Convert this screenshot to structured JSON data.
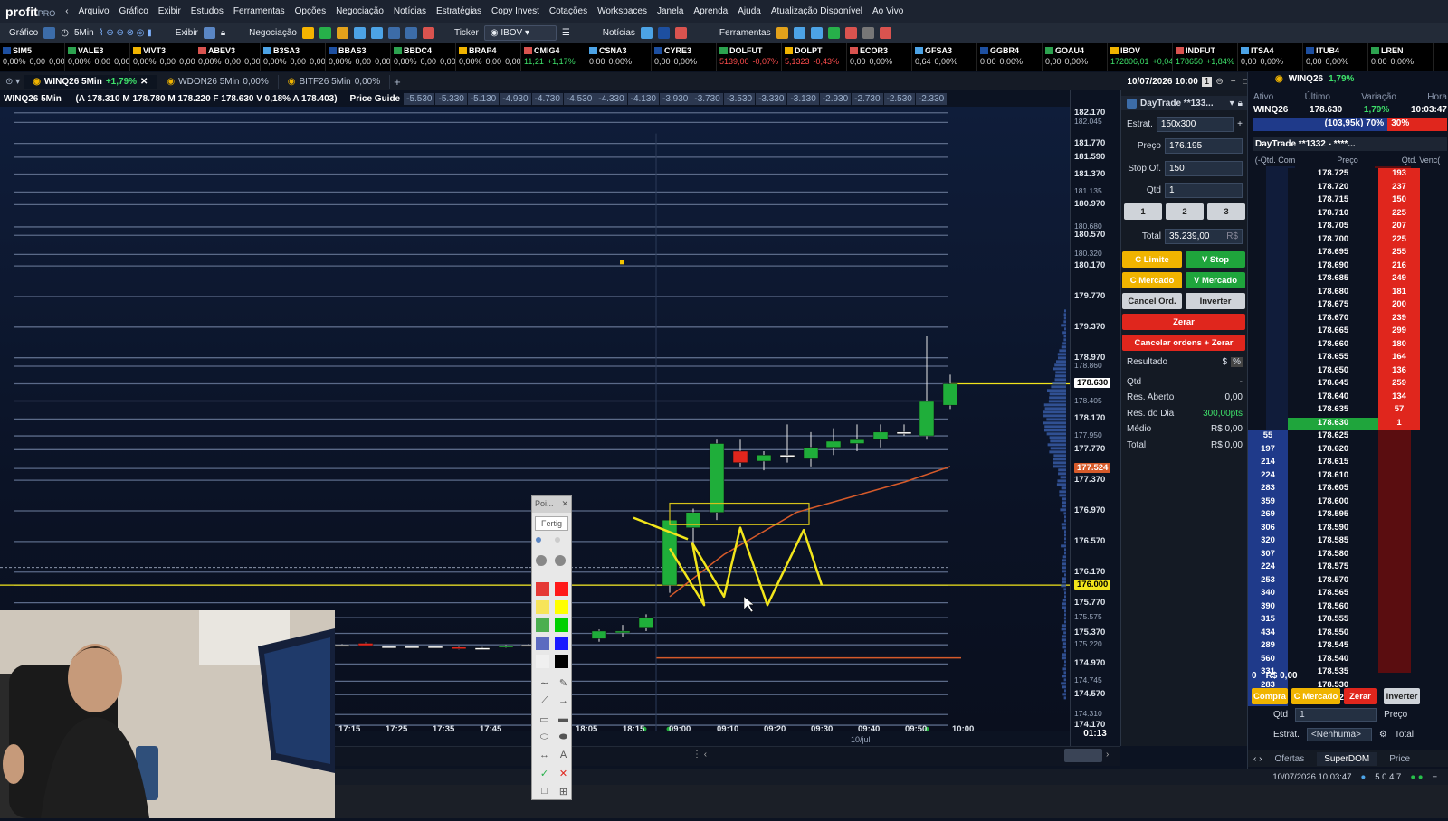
{
  "app": {
    "logo": "profit",
    "edition": "PRO"
  },
  "menu": [
    "Arquivo",
    "Gráfico",
    "Exibir",
    "Estudos",
    "Ferramentas",
    "Opções",
    "Negociação",
    "Notícias",
    "Estratégias",
    "Copy Invest",
    "Cotações",
    "Workspaces",
    "Janela",
    "Aprenda",
    "Ajuda",
    "Atualização Disponível",
    "Ao Vivo"
  ],
  "toolbar": {
    "grafico": "Gráfico",
    "interval": "5Min",
    "exibir": "Exibir",
    "negociacao": "Negociação",
    "ticker_label": "Ticker",
    "ticker_value": "IBOV",
    "noticias": "Notícias",
    "ferramentas": "Ferramentas"
  },
  "ticker_strip": [
    {
      "sym": "SIM5",
      "q": "0,00%",
      "v": "0,00",
      "c": "0,00%",
      "cls": "q"
    },
    {
      "sym": "VALE3",
      "q": "0,00%",
      "v": "0,00",
      "c": "0,00%",
      "cls": "q"
    },
    {
      "sym": "VIVT3",
      "q": "0,00%",
      "v": "0,00",
      "c": "0,00%",
      "cls": "q"
    },
    {
      "sym": "ABEV3",
      "q": "0,00%",
      "v": "0,00",
      "c": "0,00%",
      "cls": "q"
    },
    {
      "sym": "B3SA3",
      "q": "0,00%",
      "v": "0,00",
      "c": "0,00%",
      "cls": "q"
    },
    {
      "sym": "BBAS3",
      "q": "0,00%",
      "v": "0,00",
      "c": "0,00%",
      "cls": "q"
    },
    {
      "sym": "BBDC4",
      "q": "0,00%",
      "v": "0,00",
      "c": "0,00%",
      "cls": "q"
    },
    {
      "sym": "BRAP4",
      "q": "0,00%",
      "v": "0,00",
      "c": "0,00%",
      "cls": "q"
    },
    {
      "sym": "CMIG4",
      "q": "11,21",
      "v": "+1,17%",
      "c": "",
      "cls": "pos"
    },
    {
      "sym": "CSNA3",
      "q": "0,00",
      "v": "0,00%",
      "c": "",
      "cls": "q"
    },
    {
      "sym": "CYRE3",
      "q": "0,00",
      "v": "0,00%",
      "c": "",
      "cls": "q"
    },
    {
      "sym": "DOLFUT",
      "q": "5139,00",
      "v": "-0,07%",
      "c": "",
      "cls": "neg"
    },
    {
      "sym": "DOLPT",
      "q": "5,1323",
      "v": "-0,43%",
      "c": "",
      "cls": "neg"
    },
    {
      "sym": "ECOR3",
      "q": "0,00",
      "v": "0,00%",
      "c": "",
      "cls": "q"
    },
    {
      "sym": "GFSA3",
      "q": "0,64",
      "v": "0,00%",
      "c": "",
      "cls": "q"
    },
    {
      "sym": "GGBR4",
      "q": "0,00",
      "v": "0,00%",
      "c": "",
      "cls": "q"
    },
    {
      "sym": "GOAU4",
      "q": "0,00",
      "v": "0,00%",
      "c": "",
      "cls": "q"
    },
    {
      "sym": "IBOV",
      "q": "172806,01",
      "v": "+0,04%",
      "c": "",
      "cls": "pos"
    },
    {
      "sym": "INDFUT",
      "q": "178650",
      "v": "+1,84%",
      "c": "",
      "cls": "pos"
    },
    {
      "sym": "ITSA4",
      "q": "0,00",
      "v": "0,00%",
      "c": "",
      "cls": "q"
    },
    {
      "sym": "ITUB4",
      "q": "0,00",
      "v": "0,00%",
      "c": "",
      "cls": "q"
    },
    {
      "sym": "LREN",
      "q": "0,00",
      "v": "0,00%",
      "c": "",
      "cls": "q"
    }
  ],
  "tabs": [
    {
      "label": "WINQ26 5Min",
      "chg": "+1,79%",
      "active": true
    },
    {
      "label": "WDON26 5Min",
      "chg": "0,00%"
    },
    {
      "label": "BITF26 5Min",
      "chg": "0,00%"
    }
  ],
  "header_right": {
    "datetime": "10/07/2026 10:00",
    "num": "1"
  },
  "chart_info": {
    "text": "WINQ26 5Min — (A 178.310 M 178.780 M 178.220 F 178.630 V 0,18% A 178.403)",
    "price_guide": "Price Guide",
    "guides": [
      "-5.530",
      "-5.330",
      "-5.130",
      "-4.930",
      "-4.730",
      "-4.530",
      "-4.330",
      "-4.130",
      "-3.930",
      "-3.730",
      "-3.530",
      "-3.330",
      "-3.130",
      "-2.930",
      "-2.730",
      "-2.530",
      "-2.330"
    ]
  },
  "price_axis": [
    "182.170",
    "182.045",
    "181.770",
    "181.590",
    "181.370",
    "181.135",
    "180.970",
    "180.680",
    "180.570",
    "180.320",
    "180.170",
    "179.770",
    "179.370",
    "178.970",
    "178.860",
    "178.630",
    "178.405",
    "178.170",
    "177.950",
    "177.770",
    "177.524",
    "177.370",
    "176.970",
    "176.570",
    "176.170",
    "176.000",
    "175.770",
    "175.575",
    "175.370",
    "175.220",
    "174.970",
    "174.745",
    "174.570",
    "174.310",
    "174.170"
  ],
  "time_axis": [
    "17:15",
    "17:25",
    "17:35",
    "17:45",
    "18:05",
    "18:15",
    "09:00",
    "09:10",
    "09:20",
    "09:30",
    "09:40",
    "09:50",
    "10:00"
  ],
  "date_label": "10/jul",
  "countdown": "01:13",
  "order": {
    "account": "DayTrade **133...",
    "estrat_label": "Estrat.",
    "estrat": "150x300",
    "preco_label": "Preço",
    "preco": "176.195",
    "stop_label": "Stop Of.",
    "stop": "150",
    "qtd_label": "Qtd",
    "qtd": "1",
    "q1": "1",
    "q2": "2",
    "q3": "3",
    "total_label": "Total",
    "total": "35.239,00",
    "currency": "R$",
    "c_limite": "C Limite",
    "v_stop": "V Stop",
    "c_mercado": "C Mercado",
    "v_mercado": "V Mercado",
    "cancel": "Cancel Ord.",
    "inverter": "Inverter",
    "zerar": "Zerar",
    "cancelar": "Cancelar ordens + Zerar",
    "resultado": "Resultado",
    "res_sym": "$",
    "res_pct": "%",
    "rows": [
      {
        "k": "Qtd",
        "v": "-"
      },
      {
        "k": "Res. Aberto",
        "v": "0,00"
      },
      {
        "k": "Res. do Dia",
        "v": "300,00pts"
      },
      {
        "k": "Médio",
        "v": "R$ 0,00"
      },
      {
        "k": "Total",
        "v": "R$ 0,00"
      }
    ]
  },
  "dom": {
    "header": {
      "ativo": "Ativo",
      "ultimo": "Último",
      "variacao": "Variação",
      "hora": "Hora"
    },
    "sym": "WINQ26",
    "last": "178.630",
    "chg": "1,79%",
    "time": "10:03:47",
    "vol": "(103,95k) 70%",
    "pct": "30%",
    "account": "DayTrade **1332 - ****...",
    "senha": "Senha",
    "cols": [
      "(-Qtd. Com",
      "Preço",
      "Qtd. Venc("
    ],
    "asks": [
      [
        "178.725",
        "193"
      ],
      [
        "178.720",
        "237"
      ],
      [
        "178.715",
        "150"
      ],
      [
        "178.710",
        "225"
      ],
      [
        "178.705",
        "207"
      ],
      [
        "178.700",
        "225"
      ],
      [
        "178.695",
        "255"
      ],
      [
        "178.690",
        "216"
      ],
      [
        "178.685",
        "249"
      ],
      [
        "178.680",
        "181"
      ],
      [
        "178.675",
        "200"
      ],
      [
        "178.670",
        "239"
      ],
      [
        "178.665",
        "299"
      ],
      [
        "178.660",
        "180"
      ],
      [
        "178.655",
        "164"
      ],
      [
        "178.650",
        "136"
      ],
      [
        "178.645",
        "259"
      ],
      [
        "178.640",
        "134"
      ],
      [
        "178.635",
        "57"
      ],
      [
        "178.630",
        "1"
      ]
    ],
    "bids": [
      [
        "55",
        "178.625"
      ],
      [
        "197",
        "178.620"
      ],
      [
        "214",
        "178.615"
      ],
      [
        "224",
        "178.610"
      ],
      [
        "283",
        "178.605"
      ],
      [
        "359",
        "178.600"
      ],
      [
        "269",
        "178.595"
      ],
      [
        "306",
        "178.590"
      ],
      [
        "320",
        "178.585"
      ],
      [
        "307",
        "178.580"
      ],
      [
        "224",
        "178.575"
      ],
      [
        "253",
        "178.570"
      ],
      [
        "340",
        "178.565"
      ],
      [
        "390",
        "178.560"
      ],
      [
        "315",
        "178.555"
      ],
      [
        "434",
        "178.550"
      ],
      [
        "289",
        "178.545"
      ],
      [
        "560",
        "178.540"
      ],
      [
        "331",
        "178.535"
      ],
      [
        "283",
        "178.530"
      ],
      [
        "280",
        "178.525"
      ]
    ],
    "footer_qtd": "0",
    "footer_val": "R$ 0,00",
    "compra": "Compra",
    "c_mercado": "C Mercado",
    "zerar": "Zerar",
    "inverter": "Inverter",
    "qtd_label": "Qtd",
    "qtd": "1",
    "preco_label": "Preço",
    "estrat_label": "Estrat.",
    "estrat": "<Nenhuma>",
    "total_label": "Total",
    "tabs": [
      "Ofertas",
      "SuperDOM",
      "Price"
    ]
  },
  "status": {
    "datetime": "10/07/2026 10:03:47",
    "version": "5.0.4.7"
  },
  "palette": {
    "title": "Poi...",
    "fertig": "Fertig",
    "text_tool": "A"
  },
  "colors": {
    "up": "#1fae3a",
    "down": "#e0261d",
    "yellow": "#f2e51b",
    "orange": "#d65a2a"
  }
}
